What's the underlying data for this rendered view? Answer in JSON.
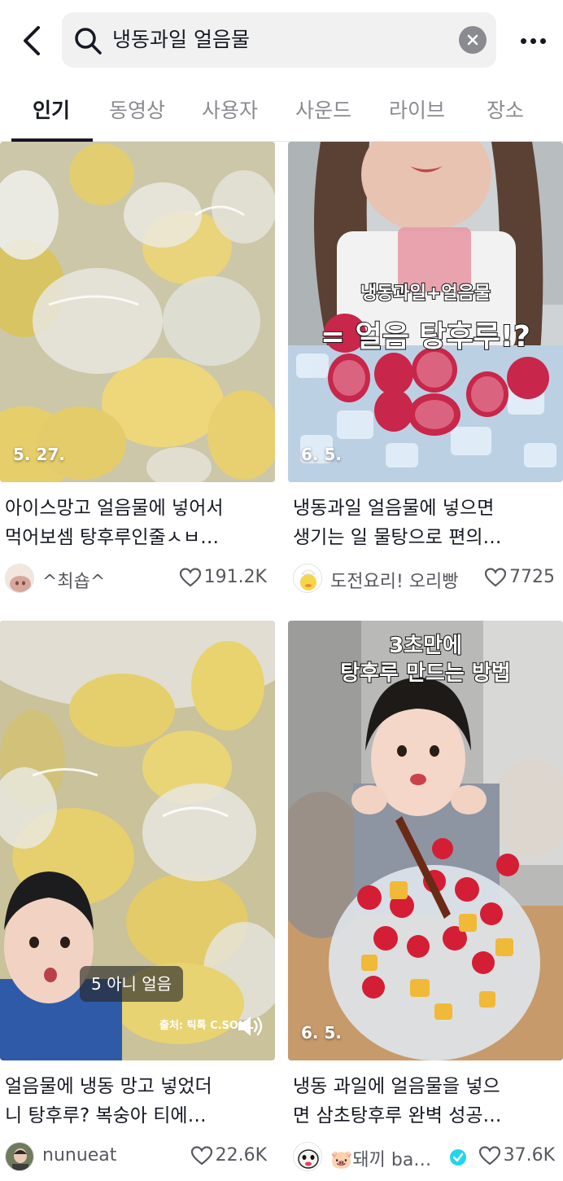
{
  "search": {
    "query": "냉동과일 얼음물"
  },
  "tabs": [
    {
      "label": "인기",
      "active": true
    },
    {
      "label": "동영상"
    },
    {
      "label": "사용자"
    },
    {
      "label": "사운드"
    },
    {
      "label": "라이브"
    },
    {
      "label": "장소"
    }
  ],
  "results": [
    {
      "date": "5. 27.",
      "title_lines": [
        "아이스망고 얼음물에 넣어서",
        "먹어보셈 탕후루인줄ㅅㅂ…"
      ],
      "author": "^최숍^",
      "likes": "191.2K"
    },
    {
      "date": "6. 5.",
      "overlay_top": "냉동과일+얼음물",
      "overlay_main": "= 얼음 탕후루!?",
      "title_lines": [
        "냉동과일 얼음물에 넣으면",
        "생기는 일 물탕으로 편의…"
      ],
      "author": "도전요리! 오리빵",
      "likes": "7725"
    },
    {
      "pill_caption": "5 아니 얼음",
      "watermark": "출처: 틱톡 C.SOUL",
      "title_lines": [
        "얼음물에 냉동 망고 넣었더",
        "니 탕후루? 복숭아 티에…"
      ],
      "author": "nunueat",
      "likes": "22.6K"
    },
    {
      "date": "6. 5.",
      "overlay_line1": "3초만에",
      "overlay_line2": "탕후루 만드는 방법",
      "title_lines": [
        "냉동 과일에 얼음물을 넣으",
        "면 삼초탕후루 완벽 성공…"
      ],
      "author": "🐷돼끼 ba…",
      "likes": "37.6K",
      "verified": true
    }
  ],
  "colors": {
    "text": "#161823",
    "secondary": "#8a8b91",
    "search_bg": "#f1f1f2",
    "verified": "#20d5ec"
  }
}
